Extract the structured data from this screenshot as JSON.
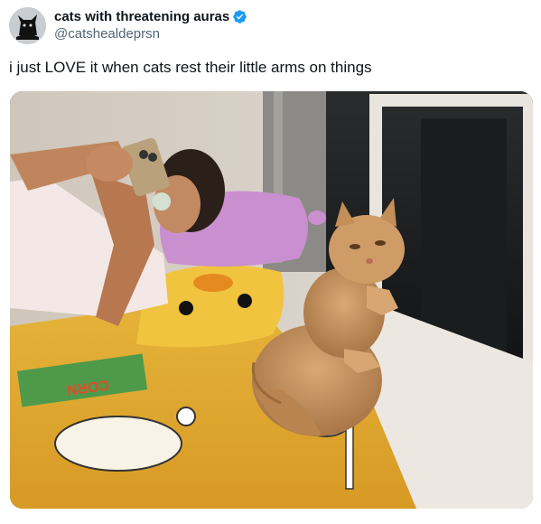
{
  "author": {
    "display_name": "cats with threatening auras",
    "handle": "@catshealdeprsn",
    "avatar_icon": "black-cat-avatar-icon",
    "verified_icon": "verified-badge-icon",
    "verified_color": "#1d9bf0"
  },
  "tweet": {
    "text": "i just LOVE it when cats rest their little arms on things"
  },
  "media": {
    "bedsheet_print": "CORN"
  }
}
